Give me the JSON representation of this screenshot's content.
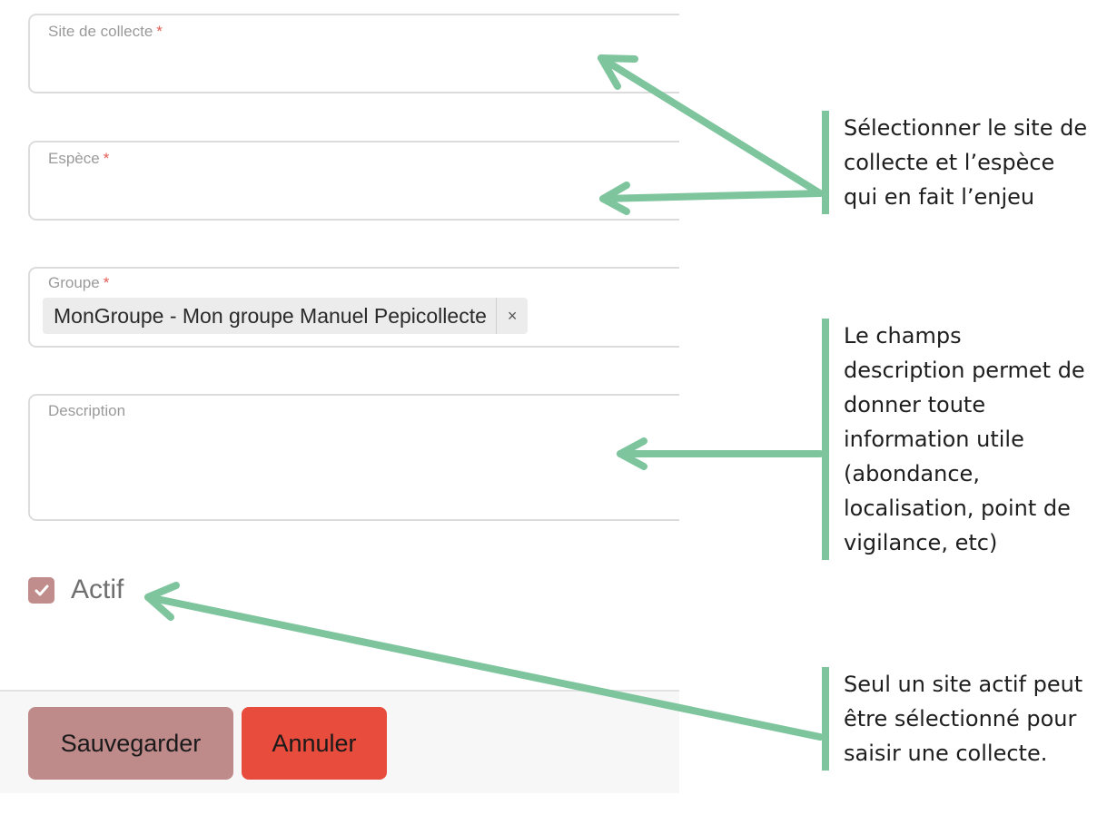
{
  "form": {
    "site_label": "Site de collecte",
    "species_label": "Espèce",
    "group_label": "Groupe",
    "required_mark": "*",
    "group_tag": "MonGroupe - Mon groupe Manuel Pepicollecte",
    "group_tag_remove": "×",
    "description_label": "Description",
    "active_label": "Actif",
    "active_checked": true,
    "save_label": "Sauvegarder",
    "cancel_label": "Annuler"
  },
  "annotations": {
    "site_species": "Sélectionner le site de collecte et l’espèce qui en fait l’enjeu",
    "description": "Le champs description permet de donner toute information utile (abondance, localisation, point de vigilance, etc)",
    "active": "Seul un site actif peut être sélectionné pour saisir une collecte."
  },
  "colors": {
    "accent_green": "#7ec59e",
    "save_button": "#bf8a8a",
    "cancel_button": "#e74c3c",
    "required": "#e25b52",
    "checkbox": "#c08c8c"
  }
}
